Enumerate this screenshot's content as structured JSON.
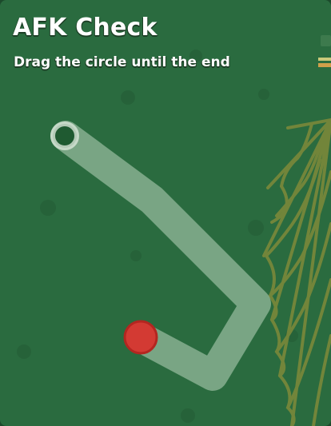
{
  "afk_check": {
    "title": "AFK Check",
    "instruction": "Drag the circle until the end"
  },
  "colors": {
    "panel_background": "#2a6b3f",
    "path": "#a9c9ae",
    "start_handle": "#d33a33",
    "end_ring": "#d9e6da",
    "web": "#7f8a3a"
  },
  "icons": {
    "start_handle": "red-circle",
    "end_target": "ring-circle",
    "decoration": "spider-web"
  }
}
